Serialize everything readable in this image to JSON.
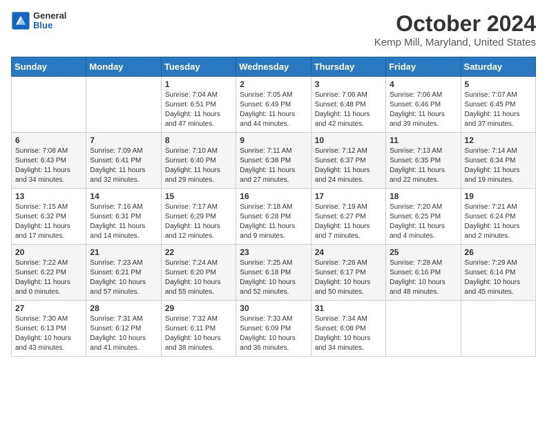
{
  "header": {
    "logo": {
      "general": "General",
      "blue": "Blue"
    },
    "title": "October 2024",
    "subtitle": "Kemp Mill, Maryland, United States"
  },
  "calendar": {
    "days_of_week": [
      "Sunday",
      "Monday",
      "Tuesday",
      "Wednesday",
      "Thursday",
      "Friday",
      "Saturday"
    ],
    "weeks": [
      [
        {
          "day": "",
          "info": ""
        },
        {
          "day": "",
          "info": ""
        },
        {
          "day": "1",
          "info": "Sunrise: 7:04 AM\nSunset: 6:51 PM\nDaylight: 11 hours and 47 minutes."
        },
        {
          "day": "2",
          "info": "Sunrise: 7:05 AM\nSunset: 6:49 PM\nDaylight: 11 hours and 44 minutes."
        },
        {
          "day": "3",
          "info": "Sunrise: 7:06 AM\nSunset: 6:48 PM\nDaylight: 11 hours and 42 minutes."
        },
        {
          "day": "4",
          "info": "Sunrise: 7:06 AM\nSunset: 6:46 PM\nDaylight: 11 hours and 39 minutes."
        },
        {
          "day": "5",
          "info": "Sunrise: 7:07 AM\nSunset: 6:45 PM\nDaylight: 11 hours and 37 minutes."
        }
      ],
      [
        {
          "day": "6",
          "info": "Sunrise: 7:08 AM\nSunset: 6:43 PM\nDaylight: 11 hours and 34 minutes."
        },
        {
          "day": "7",
          "info": "Sunrise: 7:09 AM\nSunset: 6:41 PM\nDaylight: 11 hours and 32 minutes."
        },
        {
          "day": "8",
          "info": "Sunrise: 7:10 AM\nSunset: 6:40 PM\nDaylight: 11 hours and 29 minutes."
        },
        {
          "day": "9",
          "info": "Sunrise: 7:11 AM\nSunset: 6:38 PM\nDaylight: 11 hours and 27 minutes."
        },
        {
          "day": "10",
          "info": "Sunrise: 7:12 AM\nSunset: 6:37 PM\nDaylight: 11 hours and 24 minutes."
        },
        {
          "day": "11",
          "info": "Sunrise: 7:13 AM\nSunset: 6:35 PM\nDaylight: 11 hours and 22 minutes."
        },
        {
          "day": "12",
          "info": "Sunrise: 7:14 AM\nSunset: 6:34 PM\nDaylight: 11 hours and 19 minutes."
        }
      ],
      [
        {
          "day": "13",
          "info": "Sunrise: 7:15 AM\nSunset: 6:32 PM\nDaylight: 11 hours and 17 minutes."
        },
        {
          "day": "14",
          "info": "Sunrise: 7:16 AM\nSunset: 6:31 PM\nDaylight: 11 hours and 14 minutes."
        },
        {
          "day": "15",
          "info": "Sunrise: 7:17 AM\nSunset: 6:29 PM\nDaylight: 11 hours and 12 minutes."
        },
        {
          "day": "16",
          "info": "Sunrise: 7:18 AM\nSunset: 6:28 PM\nDaylight: 11 hours and 9 minutes."
        },
        {
          "day": "17",
          "info": "Sunrise: 7:19 AM\nSunset: 6:27 PM\nDaylight: 11 hours and 7 minutes."
        },
        {
          "day": "18",
          "info": "Sunrise: 7:20 AM\nSunset: 6:25 PM\nDaylight: 11 hours and 4 minutes."
        },
        {
          "day": "19",
          "info": "Sunrise: 7:21 AM\nSunset: 6:24 PM\nDaylight: 11 hours and 2 minutes."
        }
      ],
      [
        {
          "day": "20",
          "info": "Sunrise: 7:22 AM\nSunset: 6:22 PM\nDaylight: 11 hours and 0 minutes."
        },
        {
          "day": "21",
          "info": "Sunrise: 7:23 AM\nSunset: 6:21 PM\nDaylight: 10 hours and 57 minutes."
        },
        {
          "day": "22",
          "info": "Sunrise: 7:24 AM\nSunset: 6:20 PM\nDaylight: 10 hours and 55 minutes."
        },
        {
          "day": "23",
          "info": "Sunrise: 7:25 AM\nSunset: 6:18 PM\nDaylight: 10 hours and 52 minutes."
        },
        {
          "day": "24",
          "info": "Sunrise: 7:26 AM\nSunset: 6:17 PM\nDaylight: 10 hours and 50 minutes."
        },
        {
          "day": "25",
          "info": "Sunrise: 7:28 AM\nSunset: 6:16 PM\nDaylight: 10 hours and 48 minutes."
        },
        {
          "day": "26",
          "info": "Sunrise: 7:29 AM\nSunset: 6:14 PM\nDaylight: 10 hours and 45 minutes."
        }
      ],
      [
        {
          "day": "27",
          "info": "Sunrise: 7:30 AM\nSunset: 6:13 PM\nDaylight: 10 hours and 43 minutes."
        },
        {
          "day": "28",
          "info": "Sunrise: 7:31 AM\nSunset: 6:12 PM\nDaylight: 10 hours and 41 minutes."
        },
        {
          "day": "29",
          "info": "Sunrise: 7:32 AM\nSunset: 6:11 PM\nDaylight: 10 hours and 38 minutes."
        },
        {
          "day": "30",
          "info": "Sunrise: 7:33 AM\nSunset: 6:09 PM\nDaylight: 10 hours and 36 minutes."
        },
        {
          "day": "31",
          "info": "Sunrise: 7:34 AM\nSunset: 6:08 PM\nDaylight: 10 hours and 34 minutes."
        },
        {
          "day": "",
          "info": ""
        },
        {
          "day": "",
          "info": ""
        }
      ]
    ]
  }
}
